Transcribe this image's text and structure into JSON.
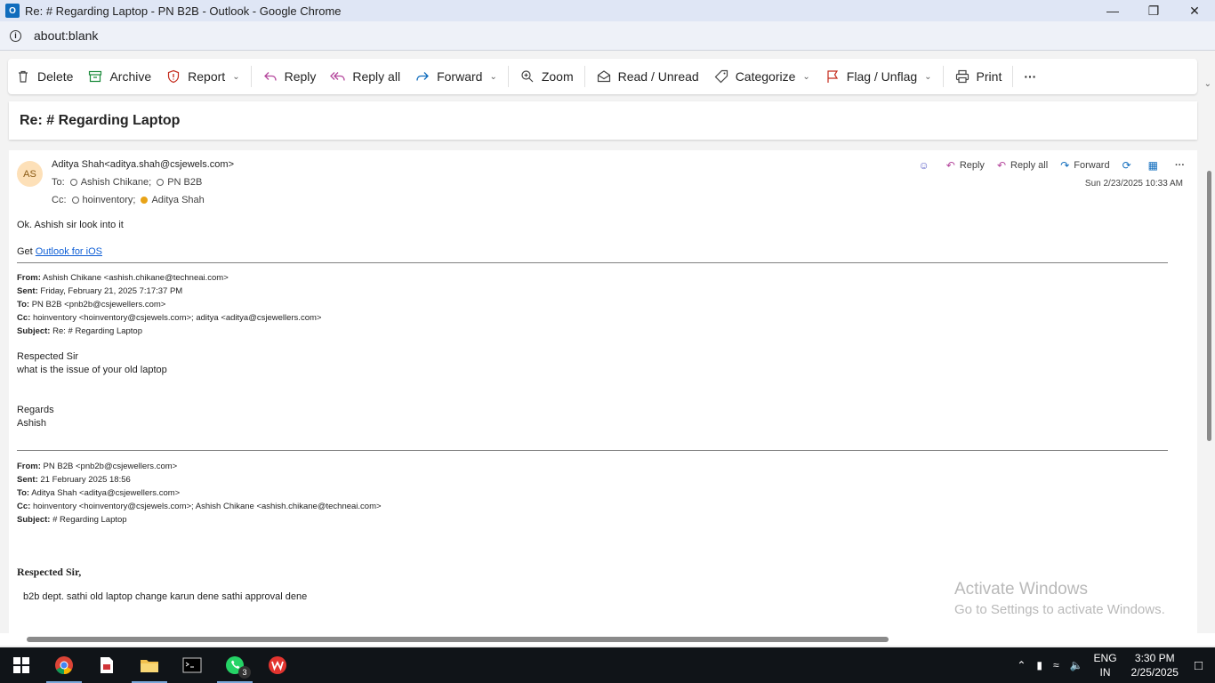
{
  "window": {
    "title": "Re: # Regarding Laptop - PN B2B - Outlook - Google Chrome",
    "url": "about:blank",
    "app_icon_letter": "O"
  },
  "toolbar": {
    "delete": "Delete",
    "archive": "Archive",
    "report": "Report",
    "reply": "Reply",
    "reply_all": "Reply all",
    "forward": "Forward",
    "zoom": "Zoom",
    "read_unread": "Read / Unread",
    "categorize": "Categorize",
    "flag_unflag": "Flag / Unflag",
    "print": "Print",
    "more": "···"
  },
  "subject": "Re: # Regarding Laptop",
  "message": {
    "avatar_initials": "AS",
    "from": "Aditya Shah<aditya.shah@csjewels.com>",
    "to_label": "To:",
    "to": [
      "Ashish Chikane;",
      "PN B2B"
    ],
    "cc_label": "Cc:",
    "cc": [
      "hoinventory;",
      "Aditya Shah"
    ],
    "date": "Sun 2/23/2025 10:33 AM",
    "actions": {
      "reply": "Reply",
      "reply_all": "Reply all",
      "forward": "Forward"
    },
    "body_line1": "Ok. Ashish sir look into it",
    "get_prefix": "Get ",
    "outlook_link": "Outlook for iOS",
    "quote1": {
      "from_label": "From:",
      "from": " Ashish Chikane <ashish.chikane@techneai.com>",
      "sent_label": "Sent:",
      "sent": " Friday, February 21, 2025 7:17:37 PM",
      "to_label": "To:",
      "to": " PN B2B <pnb2b@csjewellers.com>",
      "cc_label": "Cc:",
      "cc": " hoinventory <hoinventory@csjewels.com>; aditya <aditya@csjewellers.com>",
      "subject_label": "Subject:",
      "subject": " Re: # Regarding Laptop",
      "greeting": "Respected Sir",
      "line": "what is the issue of your old laptop",
      "regards": "Regards",
      "name": "Ashish"
    },
    "quote2": {
      "from_label": "From:",
      "from": " PN B2B <pnb2b@csjewellers.com>",
      "sent_label": "Sent:",
      "sent": " 21 February 2025 18:56",
      "to_label": "To:",
      "to": " Aditya Shah <aditya@csjewellers.com>",
      "cc_label": "Cc:",
      "cc": " hoinventory <hoinventory@csjewels.com>; Ashish Chikane <ashish.chikane@techneai.com>",
      "subject_label": "Subject:",
      "subject": " # Regarding Laptop",
      "greeting": "Respected Sir,",
      "line": "b2b dept. sathi old laptop change karun dene sathi approval dene"
    }
  },
  "watermark": {
    "line1": "Activate Windows",
    "line2": "Go to Settings to activate Windows."
  },
  "taskbar": {
    "whatsapp_badge": "3",
    "lang": "ENG",
    "region": "IN",
    "time": "3:30 PM",
    "date": "2/25/2025"
  }
}
